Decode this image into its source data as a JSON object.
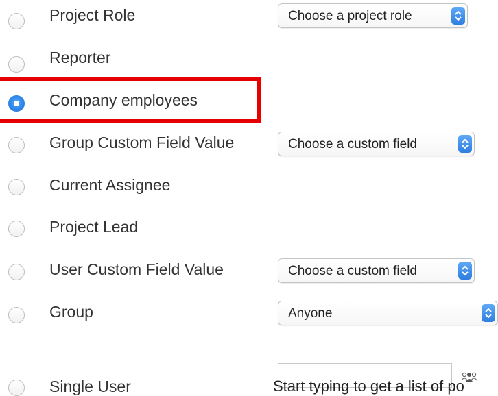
{
  "options": [
    {
      "label": "Project Role",
      "checked": false
    },
    {
      "label": "Reporter",
      "checked": false
    },
    {
      "label": "Company employees",
      "checked": true
    },
    {
      "label": "Group Custom Field Value",
      "checked": false
    },
    {
      "label": "Current Assignee",
      "checked": false
    },
    {
      "label": "Project Lead",
      "checked": false
    },
    {
      "label": "User Custom Field Value",
      "checked": false
    },
    {
      "label": "Group",
      "checked": false
    },
    {
      "label": "Single User",
      "checked": false
    }
  ],
  "selects": {
    "project_role": "Choose a project role",
    "group_custom_field": "Choose a custom field",
    "user_custom_field": "Choose a custom field",
    "group": "Anyone"
  },
  "single_user": {
    "value": "",
    "hint": "Start typing to get a list of po",
    "icon": "users-icon"
  },
  "colors": {
    "accent": "#2d86ea",
    "highlight": "#e60000"
  }
}
